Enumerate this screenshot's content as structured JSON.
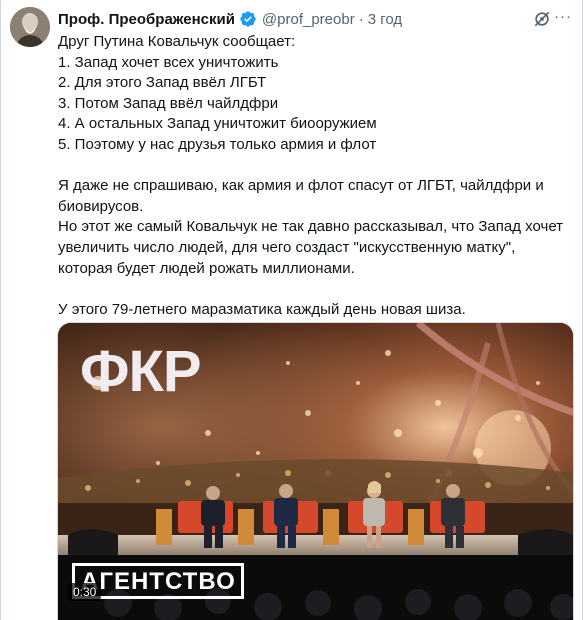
{
  "author": {
    "name": "Проф. Преображенский",
    "handle": "@prof_preobr",
    "separator": "·",
    "time": "3 год"
  },
  "icons": {
    "verified": "verified-badge-icon",
    "grok": "grok-icon",
    "more": "more-options-icon"
  },
  "colors": {
    "verified": "#1d9bf0",
    "secondary_text": "#536471",
    "text": "#0f1419"
  },
  "tweet": {
    "lines": [
      "Друг Путина Ковальчук сообщает:",
      "1. Запад хочет всех уничтожить",
      "2. Для этого Запад ввёл ЛГБТ",
      "3. Потом Запад ввёл чайлдфри",
      "4. А остальных Запад уничтожит биооружием",
      "5. Поэтому у нас друзья только армия и флот"
    ],
    "paragraph2": "Я даже не спрашиваю, как армия и флот спасут от ЛГБТ, чайлдфри и биовирусов.",
    "paragraph3": "Но этот же самый Ковальчук не так давно рассказывал, что Запад хочет увеличить число людей, для чего создаст \"искусственную матку\", которая будет людей рожать миллионами.",
    "paragraph4": "У этого 79-летнего маразматика каждый день новая шиза."
  },
  "media": {
    "stage_logo": "ФКР",
    "watermark": "АГЕНТСТВО",
    "duration": "0:30"
  }
}
